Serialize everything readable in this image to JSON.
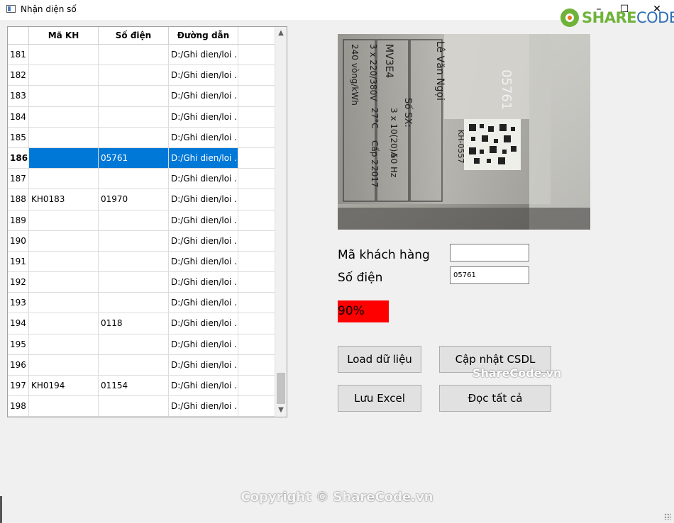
{
  "window": {
    "title": "Nhận diện số"
  },
  "brand": {
    "share": "SHARE",
    "code": "CODE.vn"
  },
  "grid": {
    "columns": [
      "",
      "Mã KH",
      "Số điện",
      "Đường dẫn"
    ],
    "rows": [
      {
        "n": "181",
        "ma": "",
        "so": "",
        "path": "D:/Ghi dien/loi ..."
      },
      {
        "n": "182",
        "ma": "",
        "so": "",
        "path": "D:/Ghi dien/loi ..."
      },
      {
        "n": "183",
        "ma": "",
        "so": "",
        "path": "D:/Ghi dien/loi ..."
      },
      {
        "n": "184",
        "ma": "",
        "so": "",
        "path": "D:/Ghi dien/loi ..."
      },
      {
        "n": "185",
        "ma": "",
        "so": "",
        "path": "D:/Ghi dien/loi ..."
      },
      {
        "n": "186",
        "ma": "",
        "so": "05761",
        "path": "D:/Ghi dien/loi ...",
        "selected": true
      },
      {
        "n": "187",
        "ma": "",
        "so": "",
        "path": "D:/Ghi dien/loi ..."
      },
      {
        "n": "188",
        "ma": "KH0183",
        "so": "01970",
        "path": "D:/Ghi dien/loi ..."
      },
      {
        "n": "189",
        "ma": "",
        "so": "",
        "path": "D:/Ghi dien/loi ..."
      },
      {
        "n": "190",
        "ma": "",
        "so": "",
        "path": "D:/Ghi dien/loi ..."
      },
      {
        "n": "191",
        "ma": "",
        "so": "",
        "path": "D:/Ghi dien/loi ..."
      },
      {
        "n": "192",
        "ma": "",
        "so": "",
        "path": "D:/Ghi dien/loi ..."
      },
      {
        "n": "193",
        "ma": "",
        "so": "",
        "path": "D:/Ghi dien/loi ..."
      },
      {
        "n": "194",
        "ma": "",
        "so": "0118",
        "path": "D:/Ghi dien/loi ..."
      },
      {
        "n": "195",
        "ma": "",
        "so": "",
        "path": "D:/Ghi dien/loi ..."
      },
      {
        "n": "196",
        "ma": "",
        "so": "",
        "path": "D:/Ghi dien/loi ..."
      },
      {
        "n": "197",
        "ma": "KH0194",
        "so": "01154",
        "path": "D:/Ghi dien/loi ..."
      },
      {
        "n": "198",
        "ma": "",
        "so": "",
        "path": "D:/Ghi dien/loi ..."
      }
    ],
    "selected_row": "186"
  },
  "meter_photo": {
    "texts": [
      "Lê Văn Ngọi",
      "MV3E4",
      "3 x 220/380V",
      "240 vòng/kWh",
      "Số SX:",
      "3 x 10(20)A",
      "27°C",
      "Cấp 2",
      "50 Hz",
      "2017",
      "KH-0557",
      "05761"
    ]
  },
  "form": {
    "ma_label": "Mã khách hàng",
    "ma_value": "",
    "so_label": "Số điện",
    "so_value": "05761",
    "confidence": "90%",
    "confidence_color": "#ff0000"
  },
  "buttons": {
    "load": "Load dữ liệu",
    "update": "Cập nhật CSDL",
    "excel": "Lưu Excel",
    "read_all": "Đọc tất cả"
  },
  "watermarks": {
    "mid": "ShareCode.vn",
    "bottom": "Copyright © ShareCode.vn"
  }
}
